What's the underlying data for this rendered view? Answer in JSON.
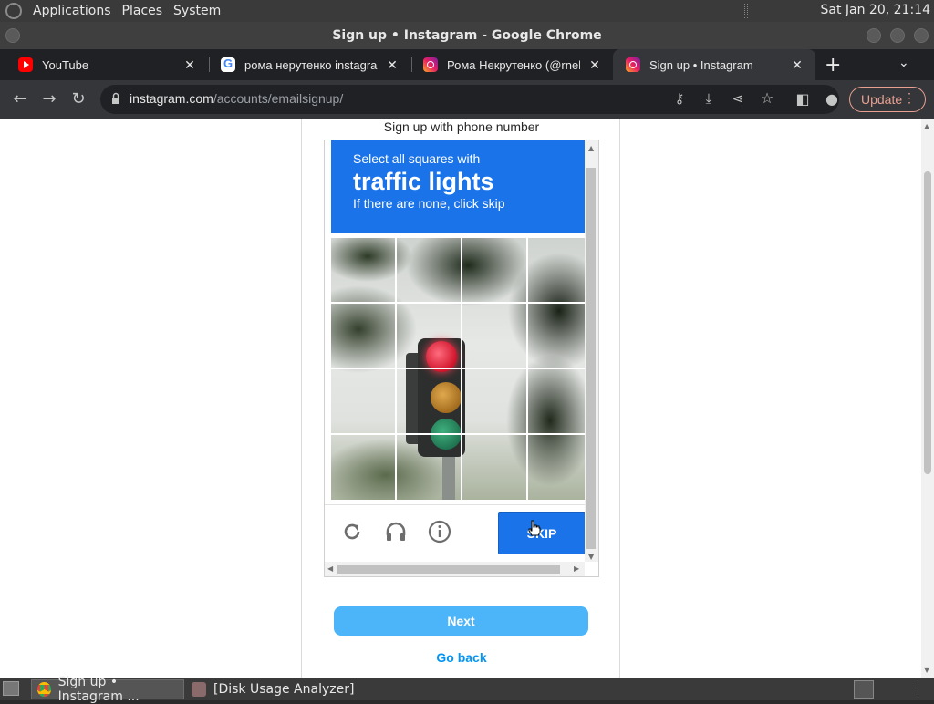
{
  "top_panel": {
    "menus": [
      "Applications",
      "Places",
      "System"
    ],
    "clock": "Sat Jan 20, 21:14"
  },
  "window": {
    "title": "Sign up • Instagram - Google Chrome"
  },
  "tabs": [
    {
      "title": "YouTube",
      "icon": "youtube-icon"
    },
    {
      "title": "рома нерутенко instagram",
      "icon": "google-icon"
    },
    {
      "title": "Рома Некрутенко (@rnek",
      "icon": "instagram-icon"
    },
    {
      "title": "Sign up • Instagram",
      "icon": "instagram-icon",
      "active": true
    }
  ],
  "toolbar": {
    "url_host": "instagram.com",
    "url_path": "/accounts/emailsignup/",
    "update_label": "Update"
  },
  "page": {
    "heading": "Sign up with phone number",
    "captcha": {
      "line1": "Select all squares with",
      "line2": "traffic lights",
      "line3": "If there are none, click skip",
      "skip_label": "SKIP",
      "grid_rows": 4,
      "grid_cols": 4
    },
    "next_label": "Next",
    "go_back_label": "Go back"
  },
  "taskbar": {
    "items": [
      {
        "label": "Sign up • Instagram ...",
        "active": true
      },
      {
        "label": "[Disk Usage Analyzer]",
        "active": false
      }
    ]
  },
  "colors": {
    "captcha_blue": "#1a73e8",
    "instagram_button": "#4cb5f9",
    "link_blue": "#0095f6",
    "update_accent": "#e8a090"
  }
}
